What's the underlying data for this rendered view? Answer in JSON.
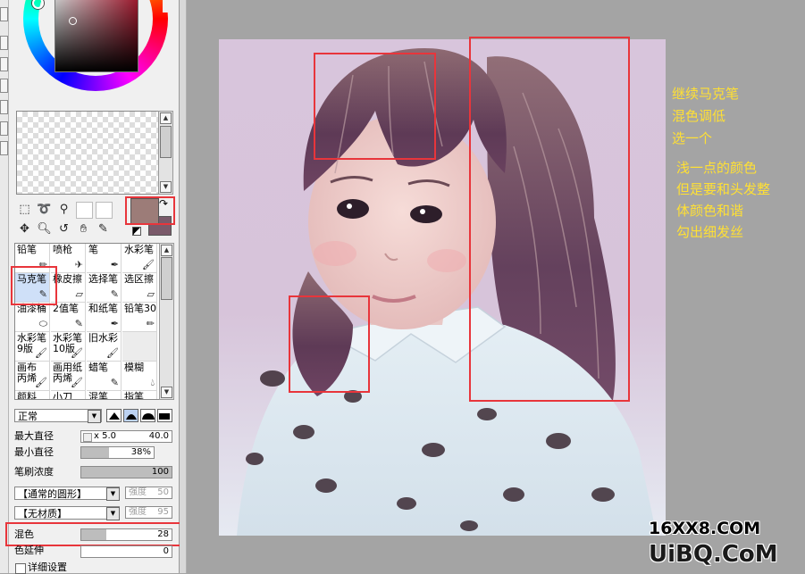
{
  "brushes": [
    {
      "label": "铅笔",
      "icon": "pencil-icon"
    },
    {
      "label": "喷枪",
      "icon": "airbrush-icon"
    },
    {
      "label": "笔",
      "icon": "pen-icon"
    },
    {
      "label": "水彩笔",
      "icon": "watercolor-icon"
    },
    {
      "label": "马克笔",
      "icon": "marker-icon",
      "selected": true
    },
    {
      "label": "橡皮擦",
      "icon": "eraser-icon"
    },
    {
      "label": "选择笔",
      "icon": "select-pen-icon"
    },
    {
      "label": "选区擦",
      "icon": "select-eraser-icon"
    },
    {
      "label": "油漆桶",
      "icon": "bucket-icon"
    },
    {
      "label": "2值笔",
      "icon": "binary-pen-icon"
    },
    {
      "label": "和纸笔",
      "icon": "washi-pen-icon"
    },
    {
      "label": "铅笔30",
      "icon": "pencil-icon"
    },
    {
      "label": "水彩笔 9版",
      "icon": "watercolor-icon"
    },
    {
      "label": "水彩笔 10版",
      "icon": "watercolor-icon"
    },
    {
      "label": "旧水彩",
      "icon": "watercolor-icon"
    },
    {
      "label": "",
      "icon": ""
    },
    {
      "label": "画布 丙烯",
      "icon": "canvas-brush-icon"
    },
    {
      "label": "画用纸 丙烯",
      "icon": "paper-brush-icon"
    },
    {
      "label": "蜡笔",
      "icon": "crayon-icon"
    },
    {
      "label": "模糊",
      "icon": "blur-icon"
    },
    {
      "label": "颜料",
      "icon": "paint-icon"
    },
    {
      "label": "小刀",
      "icon": "knife-icon"
    },
    {
      "label": "混笔",
      "icon": "blend-icon"
    },
    {
      "label": "指笔",
      "icon": "finger-icon"
    }
  ],
  "blend_mode": "正常",
  "max_size": {
    "label": "最大直径",
    "mult": "x 5.0",
    "value": "40.0"
  },
  "min_size": {
    "label": "最小直径",
    "value": "38%",
    "fraction": 0.38
  },
  "density": {
    "label": "笔刷浓度",
    "value": "100",
    "fraction": 1.0
  },
  "shape": {
    "value": "【通常的圆形】",
    "strength_label": "强度",
    "strength_value": "50"
  },
  "texture": {
    "value": "【无材质】",
    "strength_label": "强度",
    "strength_value": "95"
  },
  "mix": {
    "label": "混色",
    "value": "28",
    "fraction": 0.28
  },
  "persistence": {
    "label": "色延伸",
    "value": "0",
    "fraction": 0
  },
  "detail_settings": "详细设置",
  "colors": {
    "main": "#9c7c78",
    "sub": "#7a5a6a",
    "annotation": "#e8353b",
    "note": "#ffe034"
  },
  "notes": [
    "继续马克笔",
    "混色调低",
    "选一个",
    "浅一点的颜色",
    "但是要和头发整",
    "体颜色和谐",
    "勾出细发丝"
  ],
  "watermark": {
    "line1": "16XX8.COM",
    "line2": "UiBQ.CoM"
  }
}
